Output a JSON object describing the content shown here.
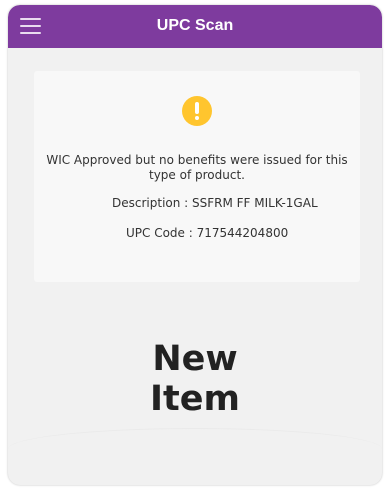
{
  "header": {
    "title": "UPC Scan",
    "menu_icon": "hamburger-icon",
    "color": "#7e3b9e"
  },
  "result": {
    "status_icon": "warning-icon",
    "status_color": "#ffc52e",
    "message": "WIC Approved but no benefits were issued for this type of product.",
    "description_label": "Description : SSFRM FF MILK-1GAL",
    "upc_label": "UPC Code : 717544204800"
  },
  "action": {
    "new_item_line1": "New",
    "new_item_line2": "Item"
  }
}
